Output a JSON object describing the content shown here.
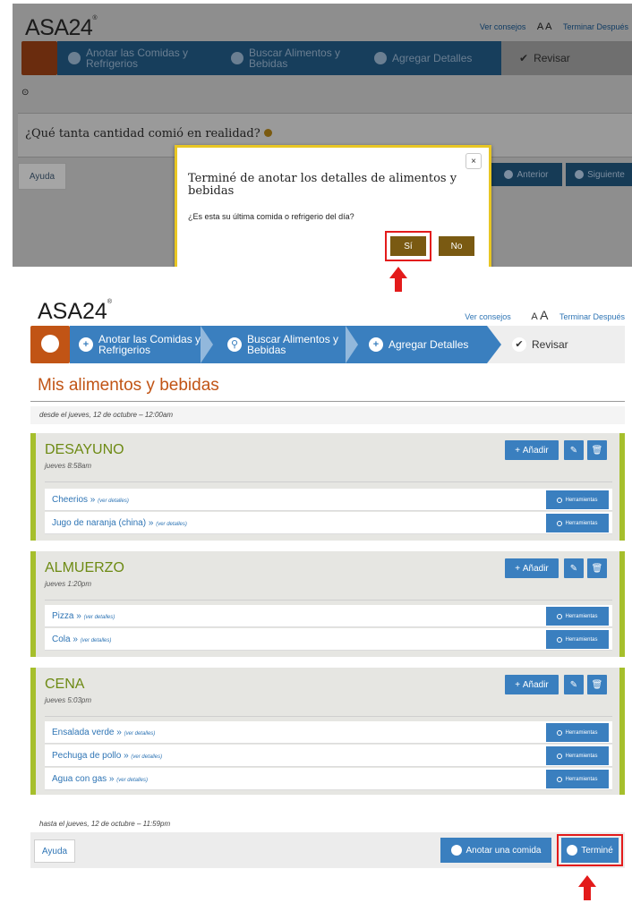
{
  "top": {
    "logo": "ASA24",
    "toplinks": {
      "tips": "Ver consejos",
      "aa": "A A",
      "finish_later": "Terminar Después"
    },
    "nav": [
      {
        "label": "Anotar las Comidas y Refrigerios"
      },
      {
        "label": "Buscar Alimentos y Bebidas"
      },
      {
        "label": "Agregar Detalles"
      },
      {
        "label": "Revisar"
      }
    ],
    "question": "¿Qué tanta cantidad comió en realidad?",
    "help": "Ayuda",
    "prev": "Anterior",
    "next": "Siguiente",
    "modal": {
      "close": "×",
      "title": "Terminé de anotar los detalles de alimentos y bebidas",
      "question": "¿Es esta su última comida o refrigerio del día?",
      "yes": "Sí",
      "no": "No"
    }
  },
  "bottom": {
    "logo": "ASA24",
    "toplinks": {
      "tips": "Ver consejos",
      "a_small": "A",
      "a_large": "A",
      "finish_later": "Terminar Después"
    },
    "nav": [
      {
        "label": "Anotar las Comidas y Refrigerios"
      },
      {
        "label": "Buscar Alimentos y Bebidas"
      },
      {
        "label": "Agregar Detalles"
      },
      {
        "label": "Revisar"
      }
    ],
    "page_title": "Mis alimentos y bebidas",
    "since": "desde el jueves, 12 de octubre – 12:00am",
    "until": "hasta el jueves, 12 de octubre – 11:59pm",
    "add_label": "Añadir",
    "tools_label": "Herramientas",
    "details_label": "(ver detalles)",
    "meals": [
      {
        "name": "DESAYUNO",
        "time": "jueves 8:58am",
        "foods": [
          "Cheerios »",
          "Jugo de naranja (china) »"
        ]
      },
      {
        "name": "ALMUERZO",
        "time": "jueves 1:20pm",
        "foods": [
          "Pizza »",
          "Cola »"
        ]
      },
      {
        "name": "CENA",
        "time": "jueves 5:03pm",
        "foods": [
          "Ensalada verde »",
          "Pechuga de pollo »",
          "Agua con gas »"
        ]
      }
    ],
    "help": "Ayuda",
    "add_meal": "Anotar una comida",
    "done": "Terminé"
  },
  "colors": {
    "accent_blue": "#3a7fbf",
    "orange": "#c15415",
    "green": "#a6bf2c",
    "highlight_red": "#e31b1b",
    "modal_border": "#e8c623"
  }
}
